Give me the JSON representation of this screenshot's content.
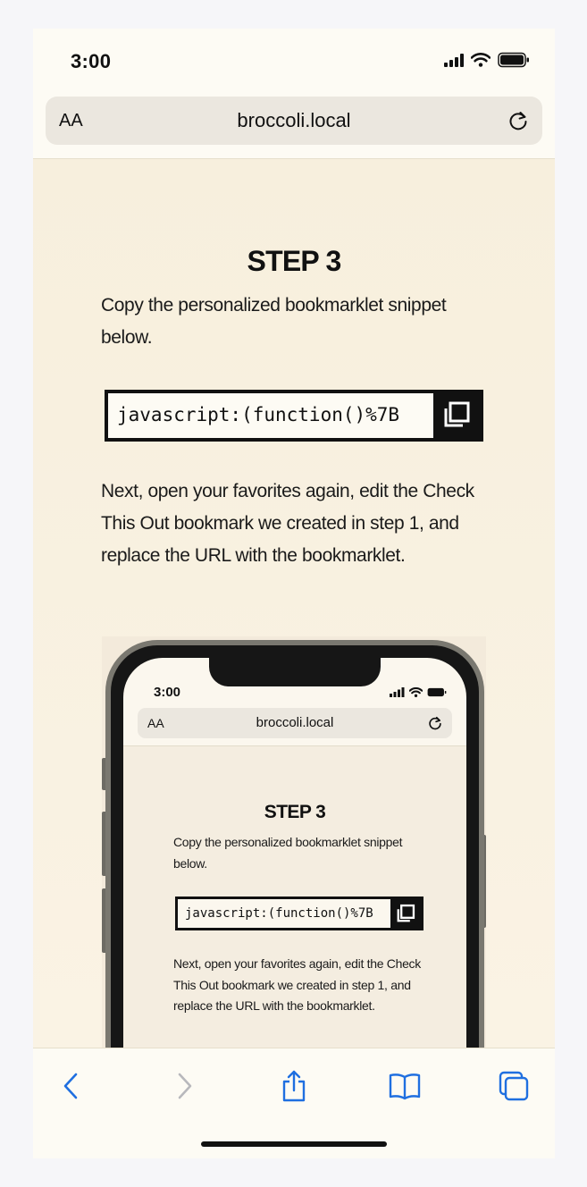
{
  "status_bar": {
    "time": "3:00"
  },
  "address_bar": {
    "text_size_label": "AA",
    "url": "broccoli.local"
  },
  "content": {
    "step_title": "STEP 3",
    "instruction": "Copy the personalized bookmarklet snippet below.",
    "snippet_code": "javascript:(function()%7B",
    "next_instruction": "Next, open your favorites again, edit the Check This Out bookmark we created in step 1, and replace the URL with the bookmarklet."
  },
  "illustration": {
    "time": "3:00",
    "text_size_label": "AA",
    "url": "broccoli.local",
    "step_title": "STEP 3",
    "instruction": "Copy the personalized bookmarklet snippet below.",
    "snippet_code": "javascript:(function()%7B",
    "next_instruction": "Next, open your favorites again, edit the Check This Out bookmark we created in step 1, and replace the URL with the bookmarklet."
  },
  "toolbar": {
    "items": [
      "back-icon",
      "forward-icon",
      "share-icon",
      "bookmarks-icon",
      "tabs-icon"
    ],
    "accent_color": "#1f6fe0",
    "disabled_color": "#b8b8bc"
  }
}
